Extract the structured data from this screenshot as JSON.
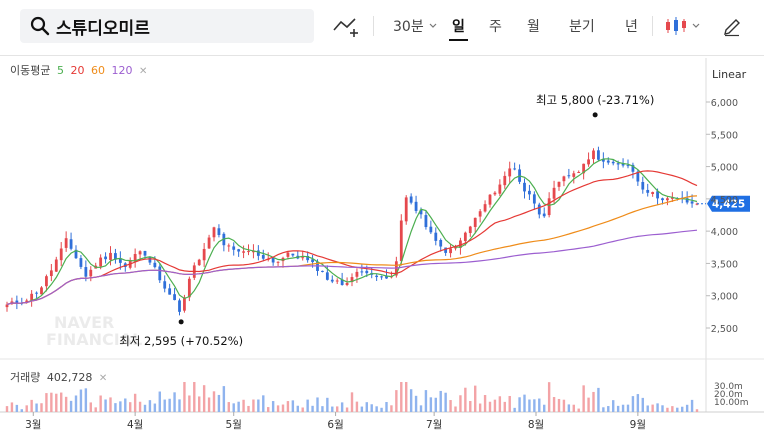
{
  "search": {
    "query": "스튜디오미르"
  },
  "toolbar": {
    "interval_label": "30분",
    "periods": [
      "일",
      "주",
      "월",
      "분기",
      "년"
    ],
    "active_period": "일"
  },
  "ma_legend": {
    "label": "이동평균",
    "periods": [
      "5",
      "20",
      "60",
      "120"
    ],
    "colors": [
      "#4caf50",
      "#e53935",
      "#ef8c1a",
      "#9c5fd0"
    ]
  },
  "scale_label": "Linear",
  "volume_legend": {
    "label": "거래량",
    "value": "402,728"
  },
  "watermark": [
    "NAVER",
    "FINANCIAL"
  ],
  "colors": {
    "up": "#e5484d",
    "down": "#2f6fd9",
    "current_badge": "#1f6fe3"
  },
  "chart_data": {
    "type": "candlestick",
    "y_scale": "linear",
    "ylim": [
      2300,
      6300
    ],
    "y_ticks": [
      2500,
      3000,
      3500,
      4000,
      4500,
      5000,
      5500,
      6000
    ],
    "y_tick_labels": [
      "2,500",
      "3,000",
      "3,500",
      "4,000",
      "4,500",
      "5,000",
      "5,500",
      "6,000"
    ],
    "x_labels": [
      "3월",
      "4월",
      "5월",
      "6월",
      "7월",
      "8월",
      "9월"
    ],
    "x_label_days": [
      0,
      31,
      61,
      92,
      122,
      153,
      184
    ],
    "current_price": 4425,
    "current_price_label": "4,425",
    "high_annotation": {
      "day": 171,
      "value": 5800,
      "text": "최고 5,800 (-23.71%)"
    },
    "low_annotation": {
      "day": 45,
      "value": 2595,
      "text": "최저 2,595 (+70.52%)"
    },
    "price_anchors": [
      [
        -8,
        2850
      ],
      [
        -2,
        2950
      ],
      [
        2,
        3100
      ],
      [
        6,
        3450
      ],
      [
        10,
        3850
      ],
      [
        13,
        3600
      ],
      [
        16,
        3300
      ],
      [
        20,
        3550
      ],
      [
        24,
        3650
      ],
      [
        28,
        3450
      ],
      [
        32,
        3700
      ],
      [
        36,
        3500
      ],
      [
        40,
        3150
      ],
      [
        43,
        2900
      ],
      [
        45,
        2750
      ],
      [
        48,
        3350
      ],
      [
        52,
        3700
      ],
      [
        55,
        4050
      ],
      [
        58,
        3800
      ],
      [
        62,
        3650
      ],
      [
        66,
        3700
      ],
      [
        70,
        3600
      ],
      [
        74,
        3520
      ],
      [
        78,
        3650
      ],
      [
        82,
        3580
      ],
      [
        86,
        3450
      ],
      [
        90,
        3250
      ],
      [
        94,
        3180
      ],
      [
        98,
        3330
      ],
      [
        102,
        3400
      ],
      [
        106,
        3250
      ],
      [
        110,
        3300
      ],
      [
        113,
        4600
      ],
      [
        116,
        4350
      ],
      [
        119,
        4150
      ],
      [
        122,
        3850
      ],
      [
        125,
        3700
      ],
      [
        128,
        3700
      ],
      [
        132,
        4000
      ],
      [
        136,
        4300
      ],
      [
        140,
        4600
      ],
      [
        143,
        4800
      ],
      [
        146,
        5050
      ],
      [
        149,
        4650
      ],
      [
        152,
        4500
      ],
      [
        155,
        4200
      ],
      [
        158,
        4600
      ],
      [
        161,
        4800
      ],
      [
        164,
        4900
      ],
      [
        167,
        4950
      ],
      [
        170,
        5250
      ],
      [
        173,
        5100
      ],
      [
        177,
        5000
      ],
      [
        181,
        5050
      ],
      [
        185,
        4700
      ],
      [
        189,
        4550
      ],
      [
        193,
        4500
      ],
      [
        197,
        4480
      ],
      [
        200,
        4440
      ],
      [
        202,
        4425
      ]
    ],
    "volume_ticks": [
      "30.0m",
      "20.0m",
      "10.00m"
    ]
  }
}
